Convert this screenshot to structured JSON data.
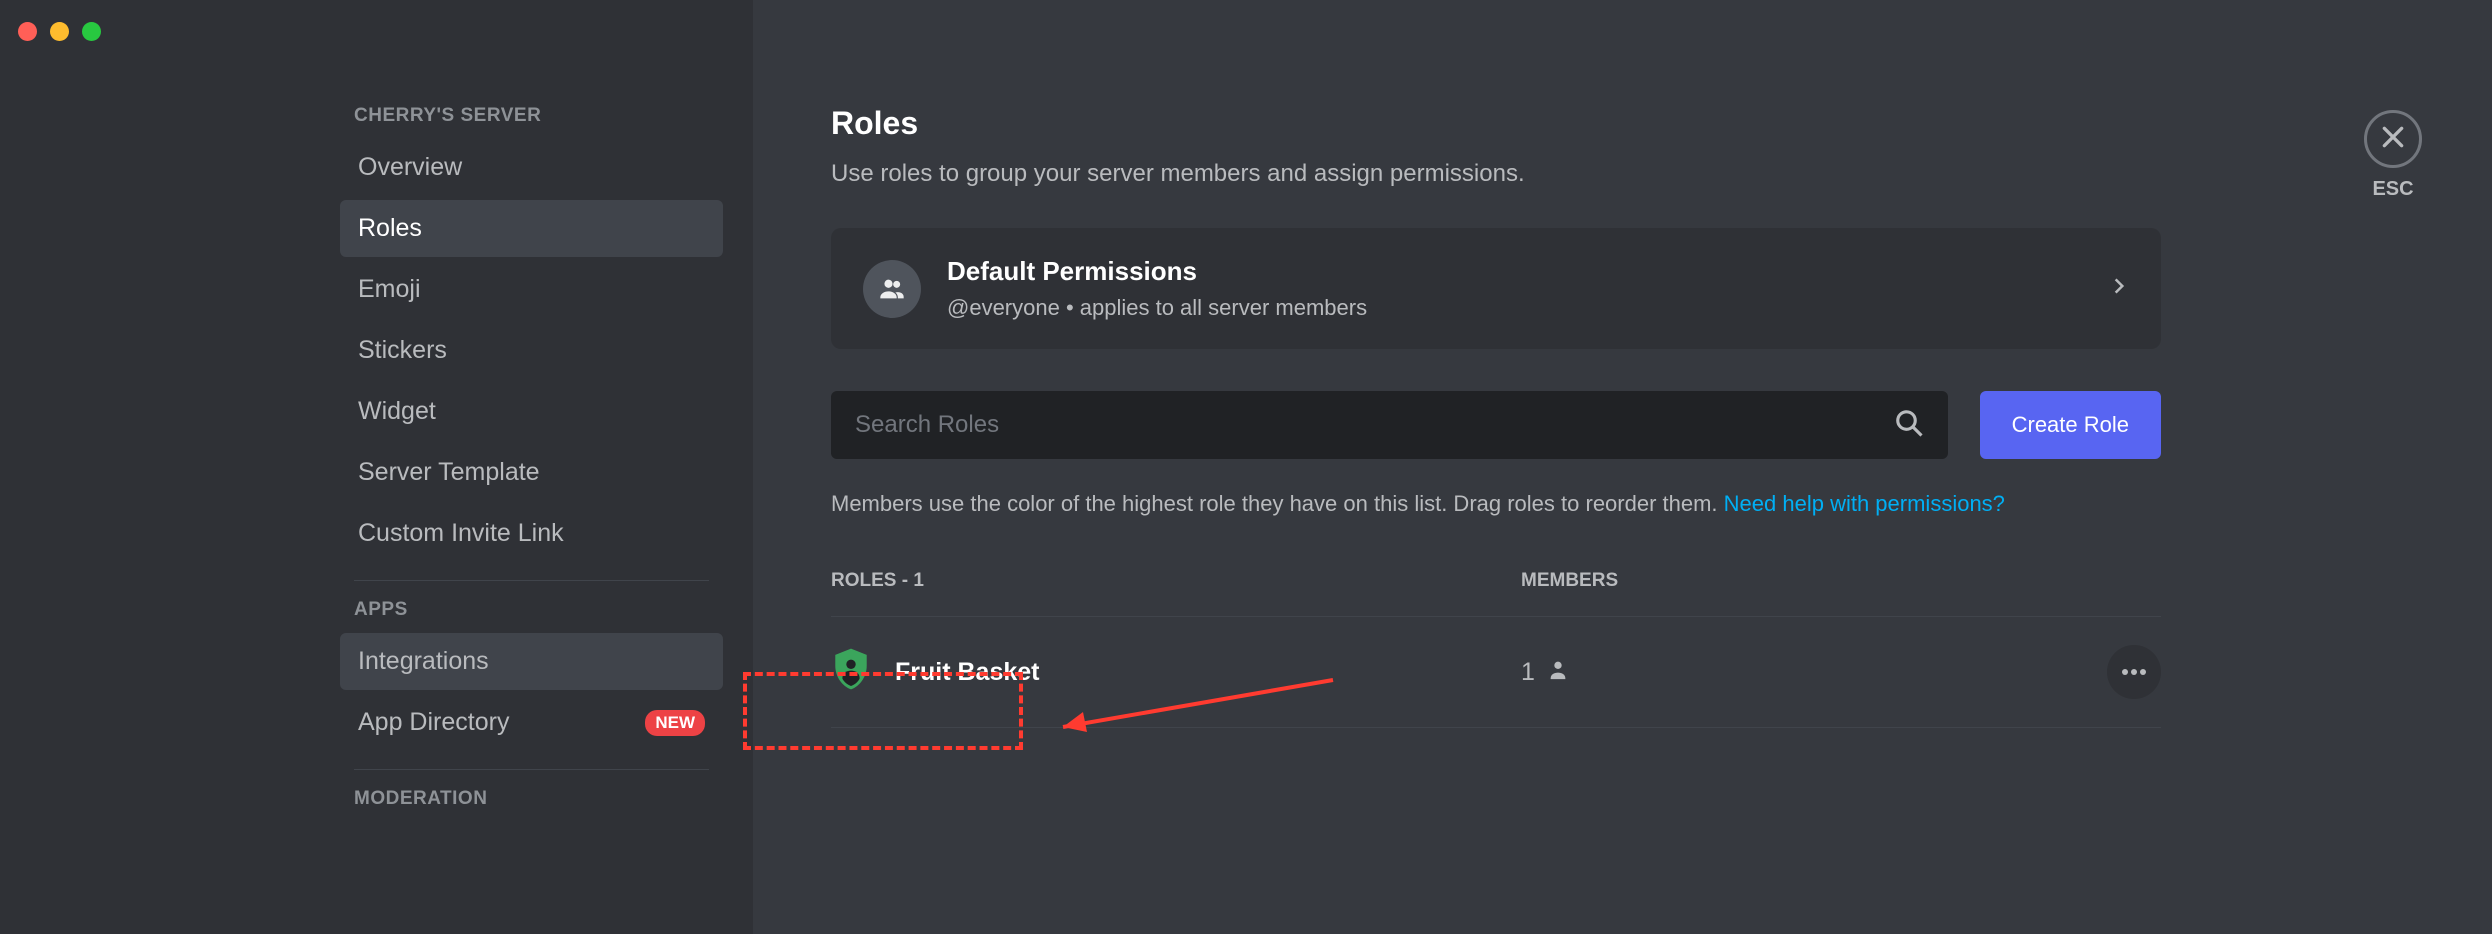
{
  "sidebar": {
    "server_heading": "CHERRY'S SERVER",
    "items_main": [
      {
        "label": "Overview",
        "active": false
      },
      {
        "label": "Roles",
        "active": true
      },
      {
        "label": "Emoji",
        "active": false
      },
      {
        "label": "Stickers",
        "active": false
      },
      {
        "label": "Widget",
        "active": false
      },
      {
        "label": "Server Template",
        "active": false
      },
      {
        "label": "Custom Invite Link",
        "active": false
      }
    ],
    "apps_heading": "APPS",
    "items_apps": [
      {
        "label": "Integrations",
        "highlight": true
      },
      {
        "label": "App Directory",
        "badge": "NEW"
      }
    ],
    "moderation_heading": "MODERATION"
  },
  "header": {
    "title": "Roles",
    "subtitle": "Use roles to group your server members and assign permissions.",
    "esc_label": "ESC"
  },
  "default_permissions": {
    "title": "Default Permissions",
    "subtitle": "@everyone • applies to all server members"
  },
  "search": {
    "placeholder": "Search Roles",
    "create_button": "Create Role"
  },
  "help": {
    "text": "Members use the color of the highest role they have on this list. Drag roles to reorder them. ",
    "link": "Need help with permissions?"
  },
  "table": {
    "roles_header": "ROLES - 1",
    "members_header": "MEMBERS",
    "rows": [
      {
        "name": "Fruit Basket",
        "shield_color": "#3ba55c",
        "member_count": "1"
      }
    ]
  }
}
